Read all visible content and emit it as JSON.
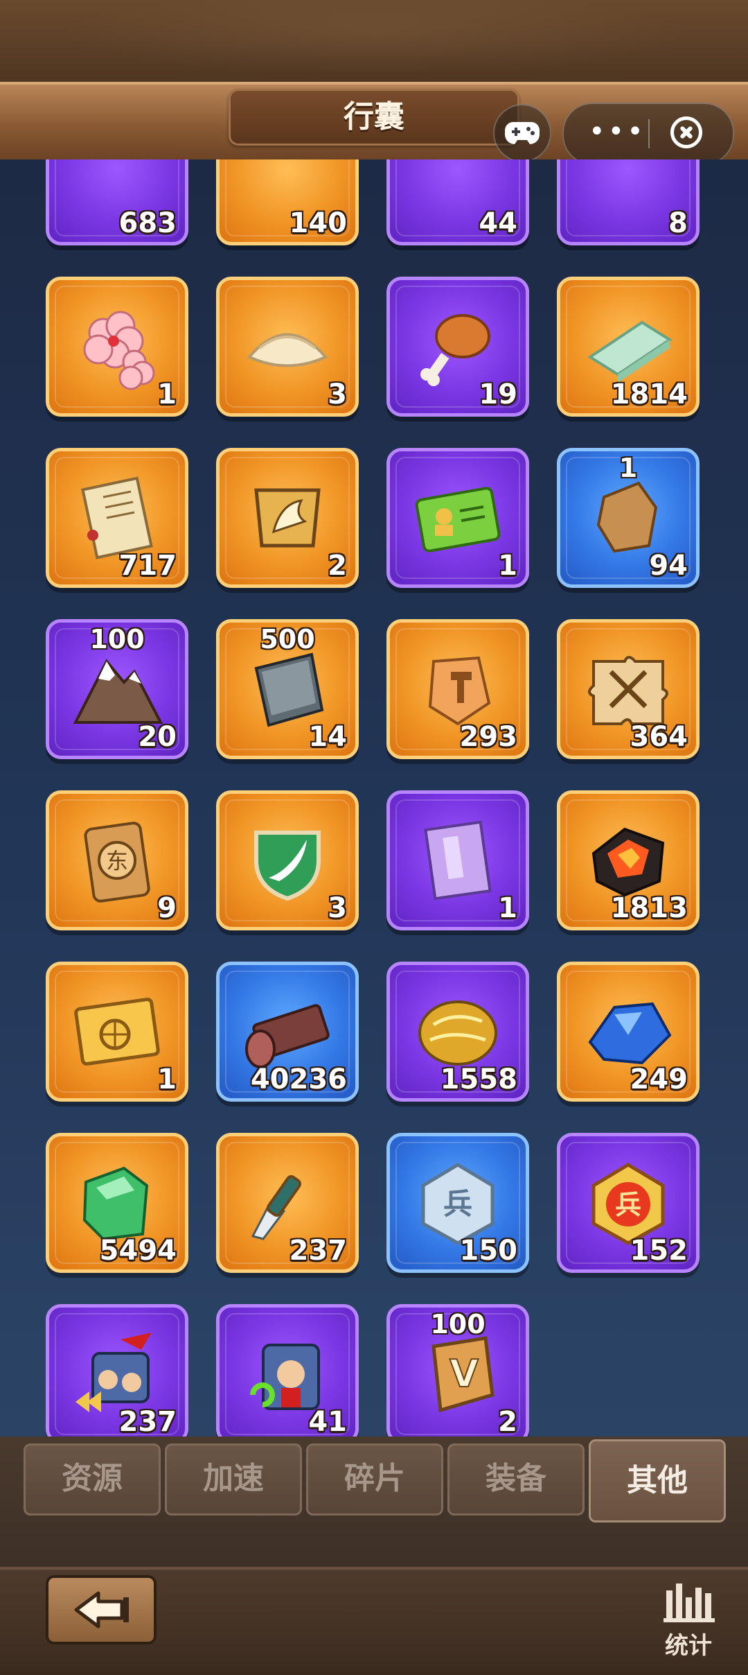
{
  "header": {
    "title": "行囊"
  },
  "mini_program": {
    "more_icon": "more-dots-icon",
    "close_icon": "close-circle-icon",
    "game_icon": "gamepad-icon"
  },
  "inventory": {
    "items": [
      {
        "icon": "wood-scraps-icon",
        "color": "purple",
        "count": "683",
        "top": ""
      },
      {
        "icon": "gold-coil-icon",
        "color": "orange",
        "count": "140",
        "top": ""
      },
      {
        "icon": "bun-icon",
        "color": "purple",
        "count": "44",
        "top": ""
      },
      {
        "icon": "bread-icon",
        "color": "purple",
        "count": "8",
        "top": ""
      },
      {
        "icon": "plum-blossom-icon",
        "color": "orange",
        "count": "1",
        "top": ""
      },
      {
        "icon": "dumpling-icon",
        "color": "orange",
        "count": "3",
        "top": ""
      },
      {
        "icon": "chicken-leg-icon",
        "color": "purple",
        "count": "19",
        "top": ""
      },
      {
        "icon": "jade-bar-icon",
        "color": "orange",
        "count": "1814",
        "top": ""
      },
      {
        "icon": "scroll-icon",
        "color": "orange",
        "count": "717",
        "top": ""
      },
      {
        "icon": "horse-token-icon",
        "color": "orange",
        "count": "2",
        "top": ""
      },
      {
        "icon": "id-card-icon",
        "color": "purple",
        "count": "1",
        "top": ""
      },
      {
        "icon": "stone-icon",
        "color": "blue",
        "count": "94",
        "top": "1"
      },
      {
        "icon": "mountain-icon",
        "color": "purple",
        "count": "20",
        "top": "100"
      },
      {
        "icon": "iron-ingot-icon",
        "color": "orange",
        "count": "14",
        "top": "500"
      },
      {
        "icon": "hammer-ore-icon",
        "color": "orange",
        "count": "293",
        "top": ""
      },
      {
        "icon": "sword-puzzle-icon",
        "color": "orange",
        "count": "364",
        "top": ""
      },
      {
        "icon": "east-token-icon",
        "color": "orange",
        "count": "9",
        "top": ""
      },
      {
        "icon": "shield-feather-icon",
        "color": "orange",
        "count": "3",
        "top": ""
      },
      {
        "icon": "book-icon",
        "color": "purple",
        "count": "1",
        "top": ""
      },
      {
        "icon": "lava-rock-icon",
        "color": "orange",
        "count": "1813",
        "top": ""
      },
      {
        "icon": "chariot-card-icon",
        "color": "orange",
        "count": "1",
        "top": ""
      },
      {
        "icon": "log-icon",
        "color": "blue",
        "count": "40236",
        "top": ""
      },
      {
        "icon": "gold-ore-icon",
        "color": "purple",
        "count": "1558",
        "top": ""
      },
      {
        "icon": "sapphire-icon",
        "color": "orange",
        "count": "249",
        "top": ""
      },
      {
        "icon": "emerald-icon",
        "color": "orange",
        "count": "5494",
        "top": ""
      },
      {
        "icon": "dagger-icon",
        "color": "orange",
        "count": "237",
        "top": ""
      },
      {
        "icon": "silver-medal-icon",
        "color": "blue",
        "count": "150",
        "top": ""
      },
      {
        "icon": "red-medal-icon",
        "color": "purple",
        "count": "152",
        "top": ""
      },
      {
        "icon": "troops-advance-icon",
        "color": "purple",
        "count": "237",
        "top": ""
      },
      {
        "icon": "general-return-icon",
        "color": "purple",
        "count": "41",
        "top": ""
      },
      {
        "icon": "vip-token-icon",
        "color": "purple",
        "count": "2",
        "top": "100"
      }
    ]
  },
  "tabs": [
    {
      "label": "资源",
      "active": false
    },
    {
      "label": "加速",
      "active": false
    },
    {
      "label": "碎片",
      "active": false
    },
    {
      "label": "装备",
      "active": false
    },
    {
      "label": "其他",
      "active": true
    }
  ],
  "bottom": {
    "back_icon": "back-arrow-icon",
    "stats_label": "统计",
    "stats_icon": "bar-chart-icon"
  }
}
